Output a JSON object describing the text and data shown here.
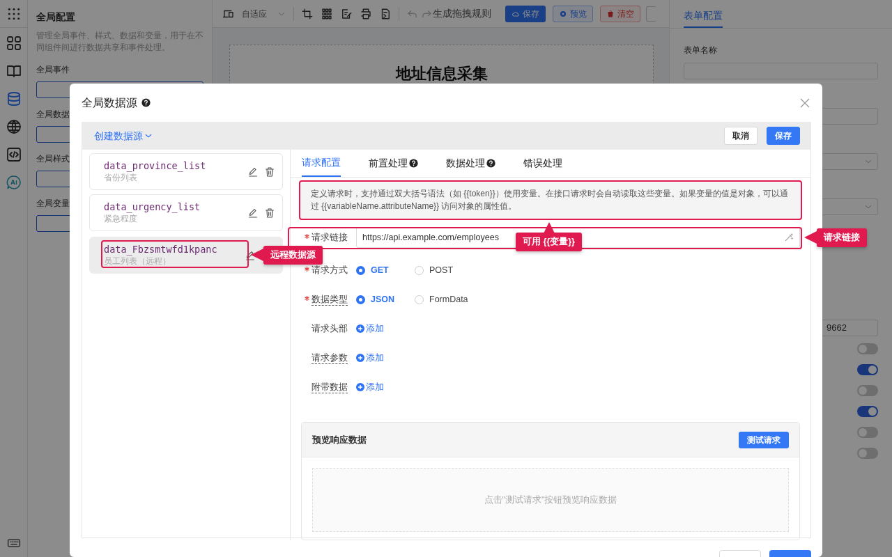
{
  "icon_rail": {
    "items": [
      {
        "selected": false
      },
      {
        "selected": false
      },
      {
        "selected": true
      },
      {
        "selected": false
      },
      {
        "selected": false
      },
      {
        "selected": false
      }
    ]
  },
  "config_panel": {
    "title": "全局配置",
    "description": "管理全局事件、样式、数据和变量，用于在不同组件间进行数据共享和事件处理。",
    "sections": [
      {
        "label": "全局事件"
      },
      {
        "label": "全局数据"
      },
      {
        "label": "全局样式"
      },
      {
        "label": "全局变量"
      }
    ]
  },
  "toolbar": {
    "layout_select": "自适应",
    "generate_rule": "生成拖拽规则",
    "buttons": [
      {
        "label": "保存",
        "kind": "primary"
      },
      {
        "label": "预览",
        "kind": "outline-primary"
      },
      {
        "label": "清空",
        "kind": "outline-danger"
      }
    ]
  },
  "canvas": {
    "form_title": "地址信息采集"
  },
  "properties_panel": {
    "tabs": [
      {
        "label": "表单配置",
        "selected": true
      }
    ],
    "form_name_label": "表单名称",
    "partial_value": "9662",
    "switches": [
      {
        "on": false
      },
      {
        "on": true
      },
      {
        "on": false
      },
      {
        "on": true
      },
      {
        "on": false
      },
      {
        "on": false
      }
    ]
  },
  "dialog": {
    "title": "全局数据源",
    "create_menu": "创建数据源",
    "header_buttons": [
      {
        "label": "取消",
        "kind": "default"
      },
      {
        "label": "保存",
        "kind": "primary"
      }
    ],
    "sources": [
      {
        "name": "data_province_list",
        "description": "省份列表",
        "selected": false
      },
      {
        "name": "data_urgency_list",
        "description": "紧急程度",
        "selected": false
      },
      {
        "name": "data_Fbzsmtwfd1kpanc",
        "description": "员工列表（远程）",
        "selected": true
      }
    ],
    "tabs": [
      {
        "label": "请求配置",
        "help": false,
        "selected": true
      },
      {
        "label": "前置处理",
        "help": true,
        "selected": false
      },
      {
        "label": "数据处理",
        "help": true,
        "selected": false
      },
      {
        "label": "错误处理",
        "help": false,
        "selected": false
      }
    ],
    "notice": "定义请求时，支持通过双大括号语法（如 {{token}}）使用变量。在接口请求时会自动读取这些变量。如果变量的值是对象，可以通过 {{variableName.attributeName}} 访问对象的属性值。",
    "fields": [
      {
        "label": "请求链接",
        "required": true,
        "tooltip": false,
        "kind": "url",
        "value": "https://api.example.com/employees"
      },
      {
        "label": "请求方式",
        "required": true,
        "tooltip": false,
        "kind": "radio",
        "options": [
          {
            "label": "GET",
            "selected": true
          },
          {
            "label": "POST",
            "selected": false
          }
        ]
      },
      {
        "label": "数据类型",
        "required": true,
        "tooltip": true,
        "kind": "radio",
        "options": [
          {
            "label": "JSON",
            "selected": true
          },
          {
            "label": "FormData",
            "selected": false
          }
        ]
      },
      {
        "label": "请求头部",
        "required": false,
        "tooltip": false,
        "kind": "add",
        "add_label": "添加"
      },
      {
        "label": "请求参数",
        "required": false,
        "tooltip": true,
        "kind": "add",
        "add_label": "添加"
      },
      {
        "label": "附带数据",
        "required": false,
        "tooltip": true,
        "kind": "add",
        "add_label": "添加"
      }
    ],
    "preview": {
      "title": "预览响应数据",
      "button": "测试请求",
      "empty_text": "点击\"测试请求\"按钮预览响应数据"
    },
    "annotations": [
      {
        "label": "远程数据源"
      },
      {
        "label": "可用 {{变量}}"
      },
      {
        "label": "请求链接"
      }
    ]
  }
}
